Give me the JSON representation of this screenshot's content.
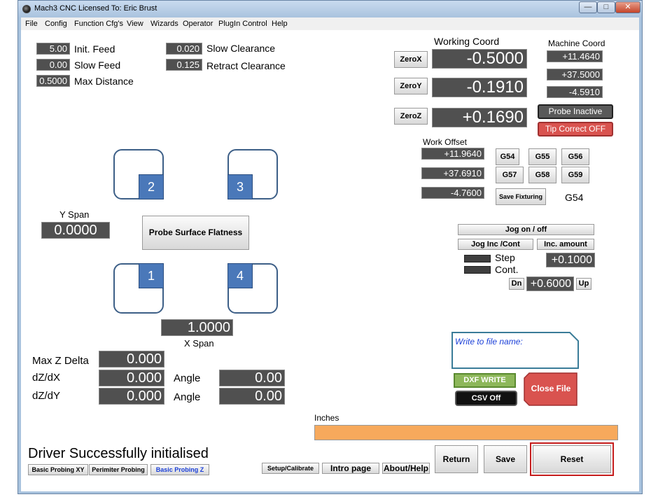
{
  "window": {
    "title": "Mach3 CNC  Licensed To: Eric Brust",
    "controls": {
      "minimize": "—",
      "maximize": "□",
      "close": "✕"
    }
  },
  "menu": [
    "File",
    "Config",
    "Function Cfg's",
    "View",
    "Wizards",
    "Operator",
    "PlugIn Control",
    "Help"
  ],
  "params": {
    "init_feed_value": "5.00",
    "init_feed_label": "Init. Feed",
    "slow_feed_value": "0.00",
    "slow_feed_label": "Slow Feed",
    "max_distance_value": "0.5000",
    "max_distance_label": "Max Distance",
    "slow_clearance_value": "0.020",
    "slow_clearance_label": "Slow Clearance",
    "retract_clearance_value": "0.125",
    "retract_clearance_label": "Retract Clearance"
  },
  "working_coord": {
    "title": "Working Coord",
    "x": "-0.5000",
    "y": "-0.1910",
    "z": "+0.1690",
    "zero_x": "ZeroX",
    "zero_y": "ZeroY",
    "zero_z": "ZeroZ"
  },
  "machine_coord": {
    "title": "Machine Coord",
    "x": "+11.4640",
    "y": "+37.5000",
    "z": "-4.5910"
  },
  "probe_status": "Probe Inactive",
  "tip_correct": "Tip Correct OFF",
  "work_offset": {
    "title": "Work Offset",
    "x": "+11.9640",
    "y": "+37.6910",
    "z": "-4.7600",
    "g_buttons": [
      "G54",
      "G55",
      "G56",
      "G57",
      "G58",
      "G59"
    ],
    "save_fixturing": "Save Fixturing",
    "current": "G54"
  },
  "probe": {
    "corners": [
      "1",
      "2",
      "3",
      "4"
    ],
    "y_span_label": "Y Span",
    "y_span_value": "0.0000",
    "x_span_label": "X Span",
    "x_span_value": "1.0000",
    "button": "Probe Surface Flatness"
  },
  "jog": {
    "on_off": "Jog on / off",
    "inc_cont": "Jog Inc /Cont",
    "inc_amount": "Inc. amount",
    "step_label": "Step",
    "cont_label": "Cont.",
    "inc_value": "+0.1000",
    "dn": "Dn",
    "up": "Up",
    "step_value": "+0.6000"
  },
  "results": {
    "max_z_delta_label": "Max Z Delta",
    "max_z_delta": "0.000",
    "dzdx_label": "dZ/dX",
    "dzdx": "0.000",
    "dzdy_label": "dZ/dY",
    "dzdy": "0.000",
    "angle_label": "Angle",
    "angle_x": "0.00",
    "angle_y": "0.00"
  },
  "file": {
    "label": "Write to file name:",
    "dxf_write": "DXF WRITE",
    "csv_off": "CSV Off",
    "close_file": "Close File"
  },
  "units": "Inches",
  "status_message": "Driver Successfully initialised",
  "tabs": [
    "Basic Probing XY",
    "Perimiter Probing",
    "Basic Probing Z"
  ],
  "nav": {
    "setup": "Setup/Calibrate",
    "intro": "Intro page",
    "about": "About/Help",
    "return": "Return",
    "save": "Save",
    "reset": "Reset"
  },
  "colors": {
    "probe_inactive_bg": "#595959",
    "tip_correct_bg": "#d9534f",
    "dxf_bg": "#8db75a",
    "close_file_bg": "#d9534f",
    "progress_bg": "#f7a95c",
    "active_tab_text": "#1a3fd8"
  }
}
